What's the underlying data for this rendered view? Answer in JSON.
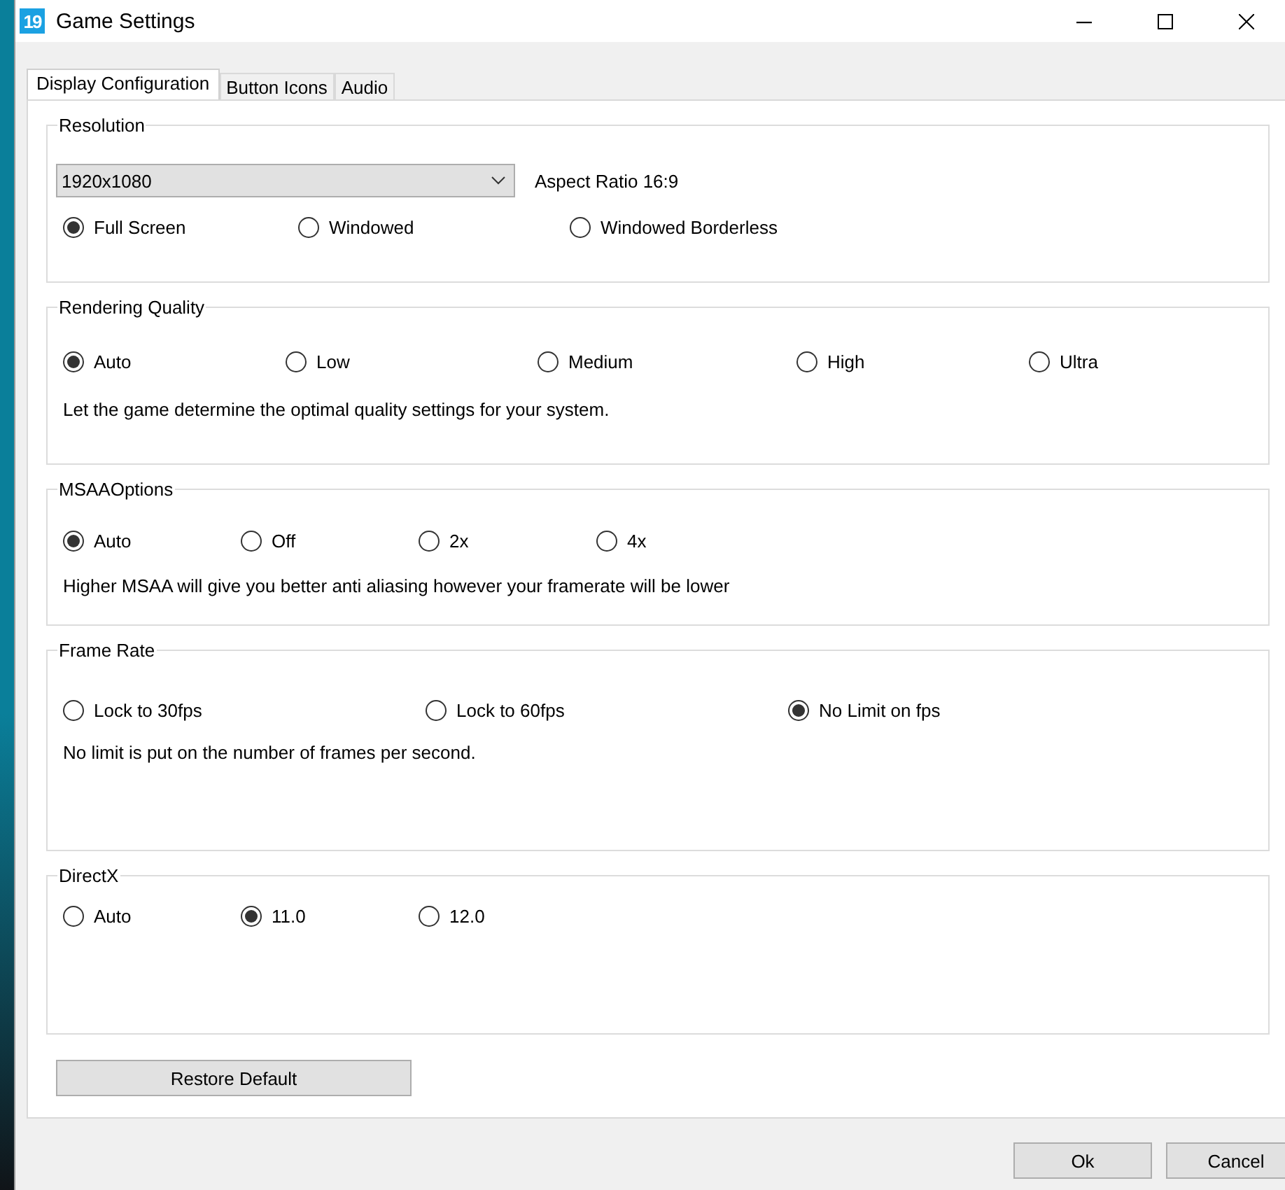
{
  "window": {
    "icon_text": "19",
    "title": "Game Settings"
  },
  "tabs": [
    {
      "label": "Display Configuration",
      "selected": true
    },
    {
      "label": "Button Icons",
      "selected": false
    },
    {
      "label": "Audio",
      "selected": false
    }
  ],
  "groups": [
    {
      "title": "Resolution",
      "dropdown": {
        "value": "1920x1080"
      },
      "aspect_label": "Aspect Ratio 16:9",
      "options": [
        {
          "label": "Full Screen",
          "selected": true
        },
        {
          "label": "Windowed",
          "selected": false
        },
        {
          "label": "Windowed Borderless",
          "selected": false
        }
      ]
    },
    {
      "title": "Rendering Quality",
      "options": [
        {
          "label": "Auto",
          "selected": true
        },
        {
          "label": "Low",
          "selected": false
        },
        {
          "label": "Medium",
          "selected": false
        },
        {
          "label": "High",
          "selected": false
        },
        {
          "label": "Ultra",
          "selected": false
        }
      ],
      "description": "Let the game determine the optimal quality settings for your system."
    },
    {
      "title": "MSAAOptions",
      "options": [
        {
          "label": "Auto",
          "selected": true
        },
        {
          "label": "Off",
          "selected": false
        },
        {
          "label": "2x",
          "selected": false
        },
        {
          "label": "4x",
          "selected": false
        }
      ],
      "description": "Higher MSAA will give you better anti aliasing however your framerate will be lower"
    },
    {
      "title": "Frame Rate",
      "options": [
        {
          "label": "Lock  to 30fps",
          "selected": false
        },
        {
          "label": "Lock to 60fps",
          "selected": false
        },
        {
          "label": "No Limit on fps",
          "selected": true
        }
      ],
      "description": "No limit is put on the number of frames per second."
    },
    {
      "title": "DirectX",
      "options": [
        {
          "label": "Auto",
          "selected": false
        },
        {
          "label": "11.0",
          "selected": true
        },
        {
          "label": "12.0",
          "selected": false
        }
      ]
    }
  ],
  "restore_button": "Restore Default",
  "dialog_buttons": [
    "Ok",
    "Cancel"
  ]
}
